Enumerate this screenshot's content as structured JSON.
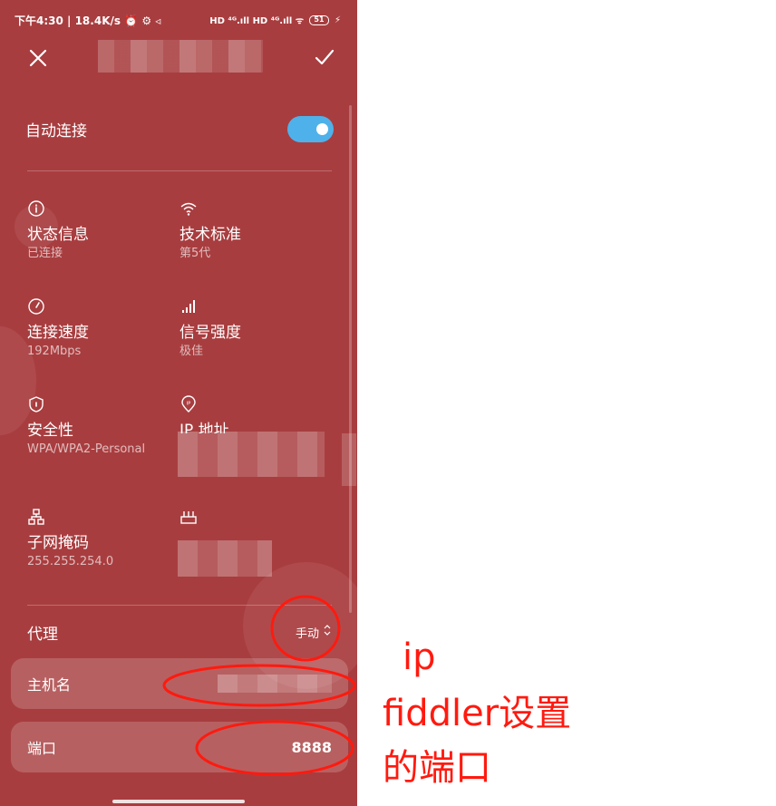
{
  "status_bar": {
    "left": "下午4:30 | 18.4K/s ⏰ ⚙ ◃",
    "right_signal": "HD ⁴ᴳ.ıll HD ⁴ᴳ.ıll ᯤ",
    "battery": "51"
  },
  "header": {
    "close_icon": "close-icon",
    "confirm_icon": "check-icon"
  },
  "auto_connect": {
    "label": "自动连接",
    "enabled": true
  },
  "info": {
    "status": {
      "title": "状态信息",
      "value": "已连接"
    },
    "standard": {
      "title": "技术标准",
      "value": "第5代"
    },
    "speed": {
      "title": "连接速度",
      "value": "192Mbps"
    },
    "signal": {
      "title": "信号强度",
      "value": "极佳"
    },
    "security": {
      "title": "安全性",
      "value": "WPA/WPA2-Personal"
    },
    "ip": {
      "title": "IP 地址"
    },
    "subnet": {
      "title": "子网掩码",
      "value": "255.255.254.0"
    }
  },
  "proxy": {
    "label": "代理",
    "value": "手动"
  },
  "hostname": {
    "label": "主机名"
  },
  "port": {
    "label": "端口",
    "value": "8888"
  },
  "annotations": {
    "line1": "ip",
    "line2": "fiddler设置",
    "line3": "的端口",
    "color": "#ff1a0f"
  },
  "colors": {
    "background": "#a83d3f",
    "toggle": "#4fb1ea"
  }
}
